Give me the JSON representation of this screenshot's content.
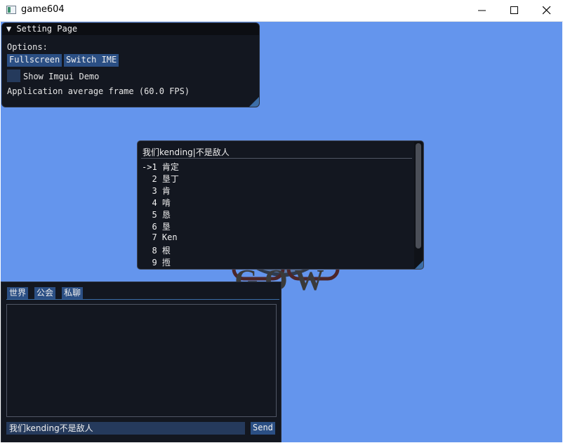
{
  "window": {
    "title": "game604"
  },
  "settings": {
    "title": "▼ Setting Page",
    "options_label": "Options:",
    "fullscreen_label": "Fullscreen",
    "switch_ime_label": "Switch IME",
    "show_demo_label": "Show Imgui Demo",
    "show_demo_checked": false,
    "fps_text": "Application average frame (60.0 FPS)"
  },
  "logo": {
    "text": "GOW"
  },
  "ime": {
    "composition": "我们kending|不是敌人",
    "candidates": [
      "->1 肯定",
      "  2 垦丁",
      "  3 肯",
      "  4 啃",
      "  5 恳",
      "  6 垦",
      "  7 Ken",
      "  8 根",
      "  9 揯"
    ]
  },
  "chat": {
    "tabs": [
      "世界",
      "公会",
      "私聊"
    ],
    "input_value": "我们kending不是敌人",
    "send_label": "Send"
  },
  "colors": {
    "background": "#6495ed",
    "window_bg": "#131720",
    "button": "#2b4f84",
    "accent": "#3c6ea8"
  }
}
